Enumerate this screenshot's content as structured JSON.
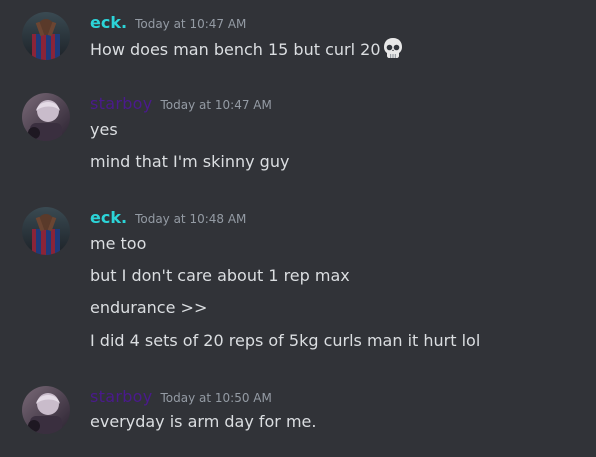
{
  "messages": [
    {
      "author": "eck.",
      "timestamp": "Today at 10:47 AM",
      "lines": [
        "How does man bench 15 but curl 20"
      ],
      "emoji": "skull-emoji"
    },
    {
      "author": "starboy",
      "timestamp": "Today at 10:47 AM",
      "lines": [
        "yes",
        "mind that I'm skinny guy"
      ]
    },
    {
      "author": "eck.",
      "timestamp": "Today at 10:48 AM",
      "lines": [
        "me too",
        "but I don't care about 1 rep max",
        "endurance >>",
        "I did 4 sets of 20 reps of 5kg curls man it hurt lol"
      ]
    },
    {
      "author": "starboy",
      "timestamp": "Today at 10:50 AM",
      "lines": [
        "everyday is arm day for me."
      ]
    }
  ],
  "colors": {
    "background": "#313338",
    "text": "#dbdee1",
    "timestamp": "#949ba4",
    "eck_name": "#2cd4d8",
    "starboy_name": "#4a1a8c"
  }
}
